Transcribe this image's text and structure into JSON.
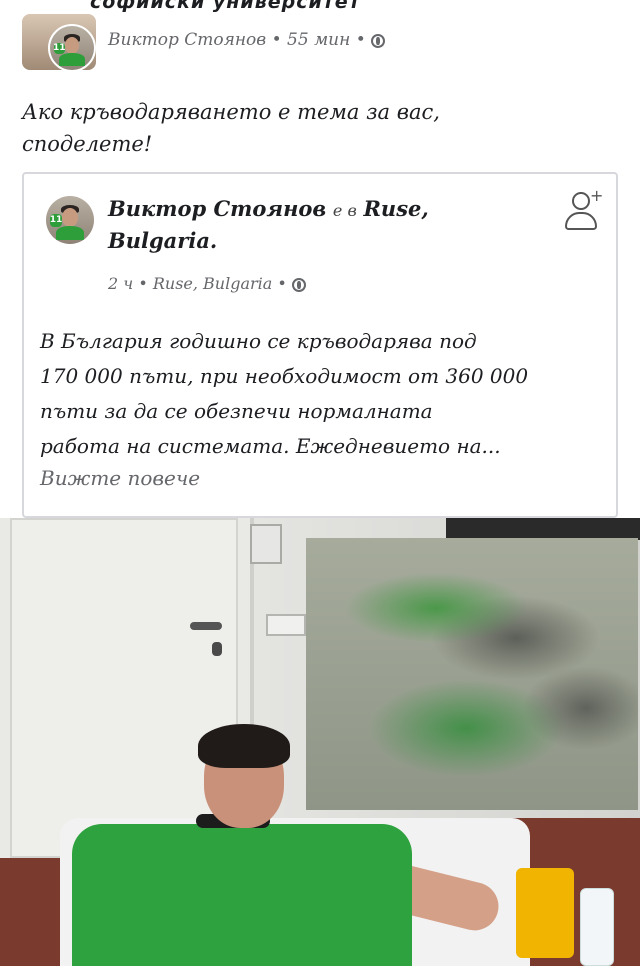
{
  "header": {
    "cut_off_title": "софийски университет",
    "author": "Виктор Стоянов",
    "time": "55 мин",
    "separator": "•"
  },
  "post": {
    "text_line1": "Ако кръводаряването е тема за вас,",
    "text_line2": "споделете!"
  },
  "shared": {
    "author_name": "Виктор Стоянов",
    "location_prefix": "е в",
    "location": "Ruse,",
    "location2": "Bulgaria.",
    "time": "2 ч",
    "place": "Ruse, Bulgaria",
    "text_line1": "В България годишно се кръводарява под",
    "text_line2": "170 000 пъти, при необходимост от 360 000",
    "text_line3": "пъти за да се обезпечи нормалната",
    "text_line4": "работа на системата. Ежедневието на...",
    "see_more": "Вижте повече"
  },
  "avatar_badge": "11",
  "icons": [
    "globe-icon",
    "add-friend-icon"
  ],
  "colors": {
    "green": "#2ea23e",
    "meta": "#65676b"
  }
}
